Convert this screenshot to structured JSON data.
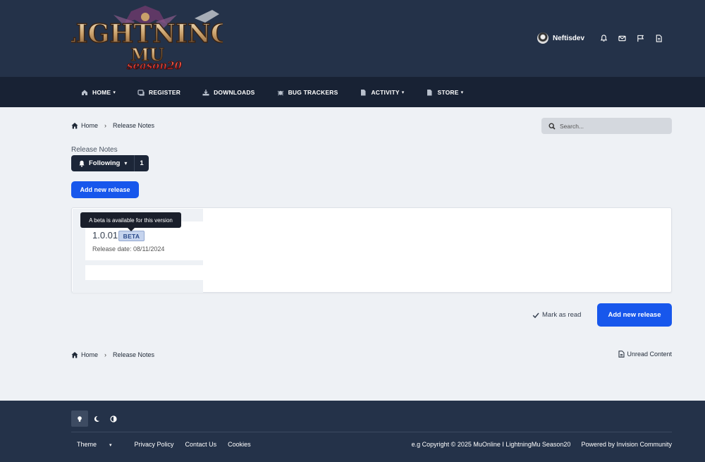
{
  "header": {
    "logo": {
      "line1": "LIGHTNING",
      "line2": "MU",
      "line3": "season20"
    },
    "user_name": "Neftisdev"
  },
  "nav": {
    "items": [
      {
        "label": "HOME",
        "has_caret": true,
        "icon": "home-icon"
      },
      {
        "label": "REGISTER",
        "has_caret": false,
        "icon": "register-icon"
      },
      {
        "label": "DOWNLOADS",
        "has_caret": false,
        "icon": "download-icon"
      },
      {
        "label": "BUG TRACKERS",
        "has_caret": false,
        "icon": "bug-icon"
      },
      {
        "label": "ACTIVITY",
        "has_caret": true,
        "icon": "document-icon"
      },
      {
        "label": "STORE",
        "has_caret": true,
        "icon": "document-icon"
      }
    ]
  },
  "breadcrumb": {
    "home": "Home",
    "current": "Release Notes"
  },
  "search": {
    "placeholder": "Search..."
  },
  "page": {
    "title": "Release Notes",
    "follow_label": "Following",
    "follow_count": "1",
    "add_release_label": "Add new release"
  },
  "release": {
    "version": "1.0.01",
    "badge": "BETA",
    "date_label": "Release date: 08/11/2024",
    "tooltip": "A beta is available for this version"
  },
  "actions": {
    "mark_read": "Mark as read",
    "add_release": "Add new release",
    "unread_content": "Unread Content"
  },
  "footer": {
    "links": [
      "Theme",
      "Privacy Policy",
      "Contact Us",
      "Cookies"
    ],
    "copyright": "e.g Copyright © 2025 MuOnline I LightningMu Season20",
    "powered": "Powered by Invision Community"
  },
  "colors": {
    "header_bg": "#243249",
    "nav_bg": "#182234",
    "accent": "#1757ec",
    "page_bg": "#eef1f5"
  }
}
